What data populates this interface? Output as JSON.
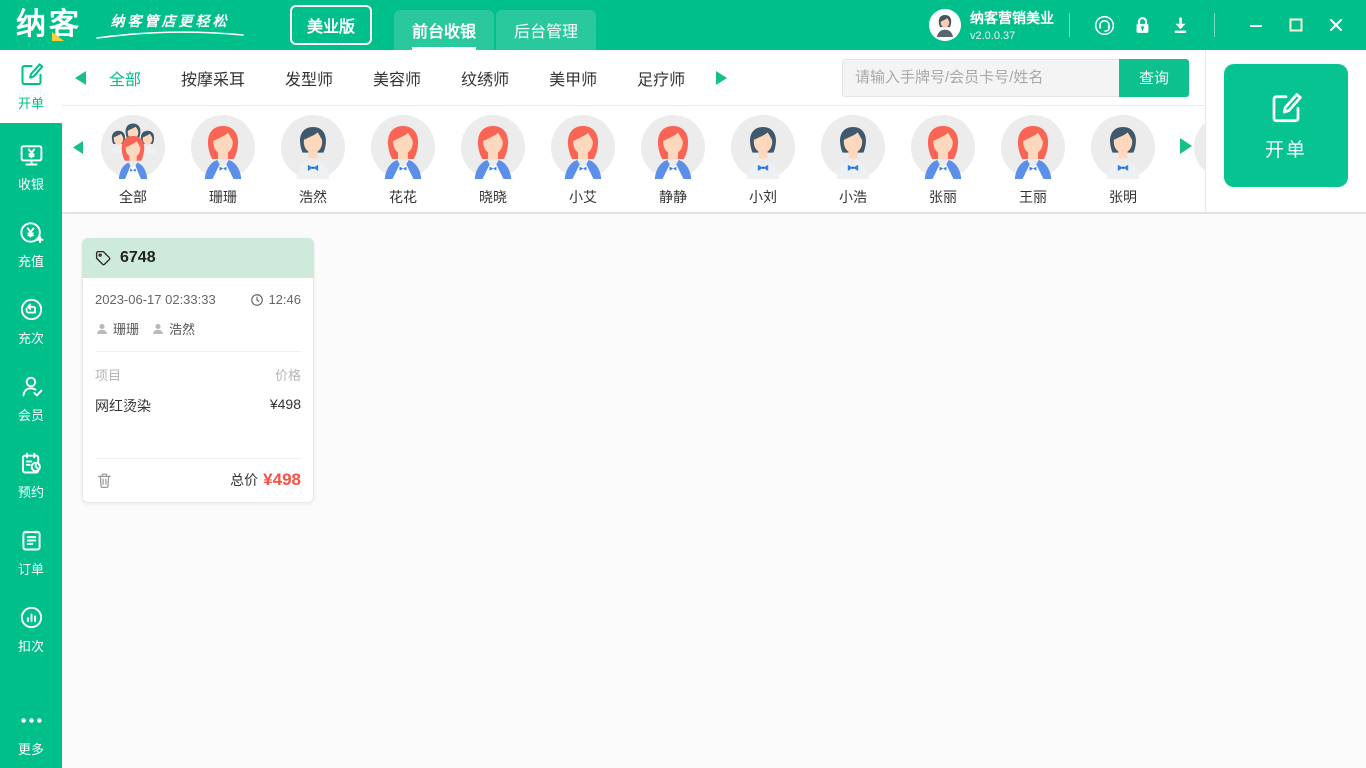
{
  "topbar": {
    "logo": "纳客",
    "tagline": "纳客管店更轻松",
    "edition_badge": "美业版",
    "tabs": [
      {
        "label": "前台收银",
        "active": true
      },
      {
        "label": "后台管理",
        "active": false
      }
    ],
    "user": {
      "name": "纳客营销美业",
      "version": "v2.0.0.37"
    },
    "icons": [
      "customer-service-icon",
      "lock-icon",
      "download-icon"
    ],
    "window_controls": [
      "minimize",
      "maximize",
      "close"
    ]
  },
  "sidebar": {
    "items": [
      {
        "label": "开单",
        "icon": "open-bill-icon",
        "active": true
      },
      {
        "label": "收银",
        "icon": "cashier-icon",
        "active": false
      },
      {
        "label": "充值",
        "icon": "recharge-icon",
        "active": false
      },
      {
        "label": "充次",
        "icon": "recharge-times-icon",
        "active": false
      },
      {
        "label": "会员",
        "icon": "member-icon",
        "active": false
      },
      {
        "label": "预约",
        "icon": "appointment-icon",
        "active": false
      },
      {
        "label": "订单",
        "icon": "orders-icon",
        "active": false
      },
      {
        "label": "扣次",
        "icon": "deduct-times-icon",
        "active": false
      }
    ],
    "more": {
      "label": "更多",
      "icon": "more-icon"
    }
  },
  "filters": {
    "categories": [
      {
        "label": "全部",
        "active": true
      },
      {
        "label": "按摩采耳",
        "active": false
      },
      {
        "label": "发型师",
        "active": false
      },
      {
        "label": "美容师",
        "active": false
      },
      {
        "label": "纹绣师",
        "active": false
      },
      {
        "label": "美甲师",
        "active": false
      },
      {
        "label": "足疗师",
        "active": false
      }
    ]
  },
  "search": {
    "placeholder": "请输入手牌号/会员卡号/姓名",
    "button": "查询"
  },
  "staff": {
    "list": [
      {
        "name": "全部",
        "avatar": "group"
      },
      {
        "name": "珊珊",
        "avatar": "female"
      },
      {
        "name": "浩然",
        "avatar": "male"
      },
      {
        "name": "花花",
        "avatar": "female"
      },
      {
        "name": "晓晓",
        "avatar": "female"
      },
      {
        "name": "小艾",
        "avatar": "female"
      },
      {
        "name": "静静",
        "avatar": "female"
      },
      {
        "name": "小刘",
        "avatar": "male"
      },
      {
        "name": "小浩",
        "avatar": "male"
      },
      {
        "name": "张丽",
        "avatar": "female"
      },
      {
        "name": "王丽",
        "avatar": "female"
      },
      {
        "name": "张明",
        "avatar": "male"
      }
    ],
    "partial_avatar": {
      "avatar": "male",
      "clipped": true
    }
  },
  "right_panel": {
    "open_bill_label": "开单"
  },
  "order_card": {
    "id": "6748",
    "datetime": "2023-06-17 02:33:33",
    "duration": "12:46",
    "staff": [
      "珊珊",
      "浩然"
    ],
    "columns": {
      "item": "项目",
      "price": "价格"
    },
    "items": [
      {
        "name": "网红烫染",
        "price": "¥498"
      }
    ],
    "total_label": "总价",
    "total_value": "¥498"
  },
  "colors": {
    "brand_green": "#00bf8b",
    "button_green": "#07c391",
    "card_header_green": "#cdeada",
    "total_red": "#fb4f44"
  }
}
